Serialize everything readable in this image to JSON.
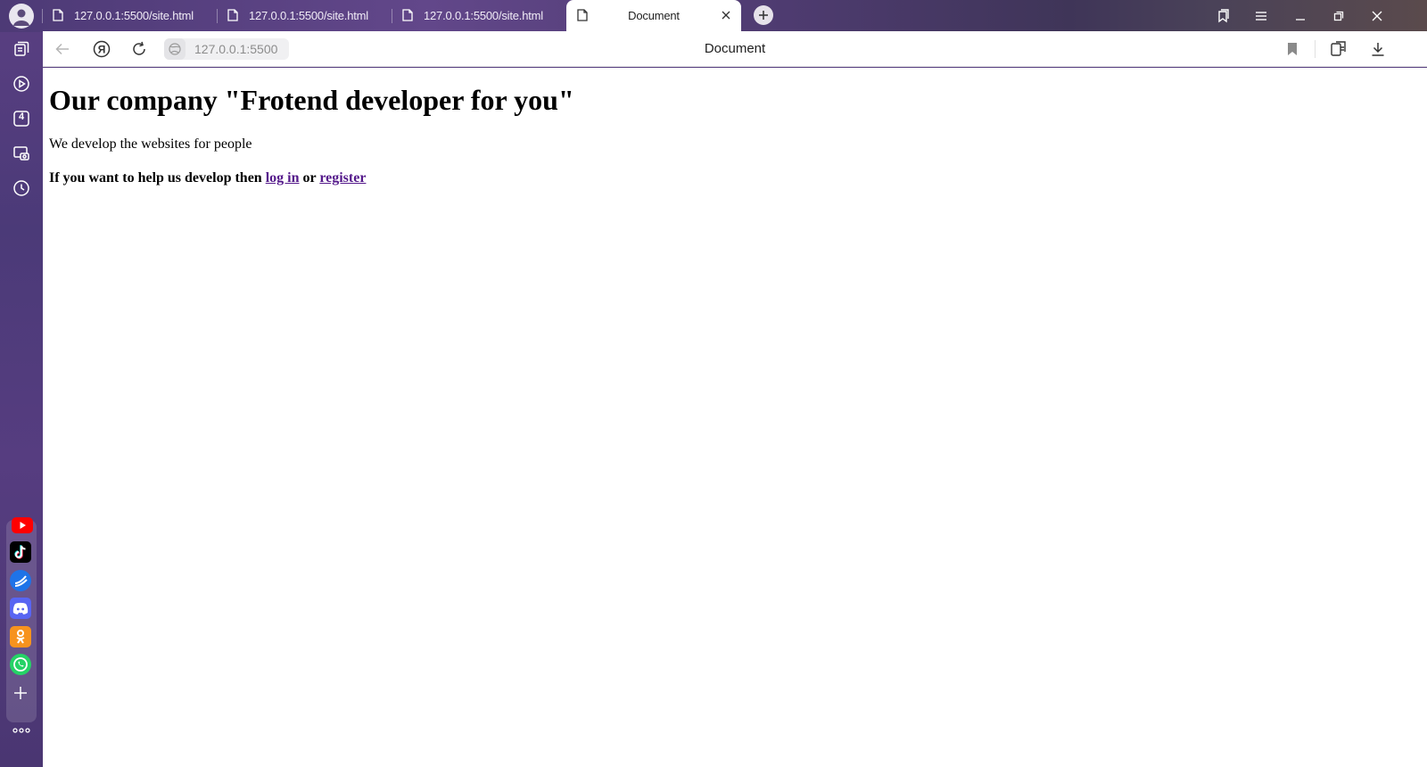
{
  "tabs": [
    {
      "label": "127.0.0.1:5500/site.html",
      "active": false
    },
    {
      "label": "127.0.0.1:5500/site.html",
      "active": false
    },
    {
      "label": "127.0.0.1:5500/site.html",
      "active": false
    },
    {
      "label": "Document",
      "active": true
    }
  ],
  "sidebar": {
    "items": [
      {
        "icon": "collections-icon"
      },
      {
        "icon": "video-play-icon"
      },
      {
        "icon": "tabs-counter-icon",
        "badge": "4"
      },
      {
        "icon": "screenshot-icon"
      },
      {
        "icon": "history-icon"
      }
    ],
    "apps": [
      "youtube-icon",
      "tiktok-icon",
      "zen-icon",
      "discord-icon",
      "odnoklassniki-icon",
      "whatsapp-icon",
      "add-app-icon"
    ],
    "more_icon": "more-dots-icon"
  },
  "toolbar": {
    "address": "127.0.0.1:5500",
    "page_title": "Document"
  },
  "page": {
    "heading": "Our company \"Frotend developer for you\"",
    "lead": "We develop the websites for people",
    "cta_prefix": "If you want to help us develop then ",
    "login_link": "log in",
    "cta_or": " or ",
    "register_link": "register"
  },
  "colors": {
    "frame_purple": "#5a3f82",
    "link_visited": "#551a8b",
    "youtube": "#ff0000",
    "discord": "#5865f2",
    "odnoklassniki": "#f7931e",
    "whatsapp": "#25d366",
    "zen": "#1e73e8"
  }
}
